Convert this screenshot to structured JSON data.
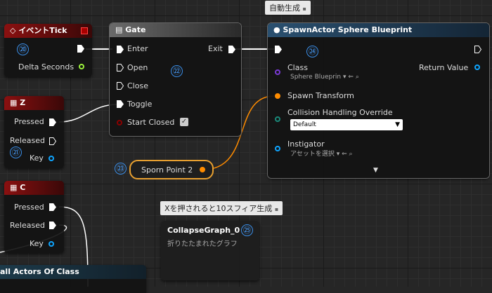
{
  "comments": {
    "auto_generate": "自動生成",
    "x_press": "Xを押されると10スフィア生成"
  },
  "event_tick": {
    "title": "イベントTick",
    "delta": "Delta Seconds",
    "badge": "⑳"
  },
  "gate": {
    "title": "Gate",
    "enter": "Enter",
    "open": "Open",
    "close": "Close",
    "toggle": "Toggle",
    "start_closed": "Start Closed",
    "exit": "Exit",
    "badge": "㉒"
  },
  "key_z": {
    "title": "Z",
    "pressed": "Pressed",
    "released": "Released",
    "key": "Key",
    "badge": "㉑"
  },
  "key_c": {
    "title": "C",
    "pressed": "Pressed",
    "released": "Released",
    "key": "Key"
  },
  "spawn": {
    "title": "SpawnActor Sphere Blueprint",
    "class_label": "Class",
    "class_value": "Sphere Blueprin",
    "return_value": "Return Value",
    "spawn_transform": "Spawn Transform",
    "collision": "Collision Handling Override",
    "collision_value": "Default",
    "instigator": "Instigator",
    "instigator_value": "アセットを選択",
    "badge": "㉔"
  },
  "sporn": {
    "label": "Sporn Point 2",
    "badge": "㉓"
  },
  "collapse": {
    "title": "CollapseGraph_0",
    "subtitle": "折りたたまれたグラフ",
    "badge": "㉕"
  },
  "get_actors": {
    "title": "all Actors Of Class"
  },
  "colors": {
    "exec": "#ffffff",
    "float": "#9cf23c",
    "object": "#0ea5ff",
    "struct": "#ff8c00",
    "class": "#7b3ad6",
    "bool": "#8b0000"
  }
}
